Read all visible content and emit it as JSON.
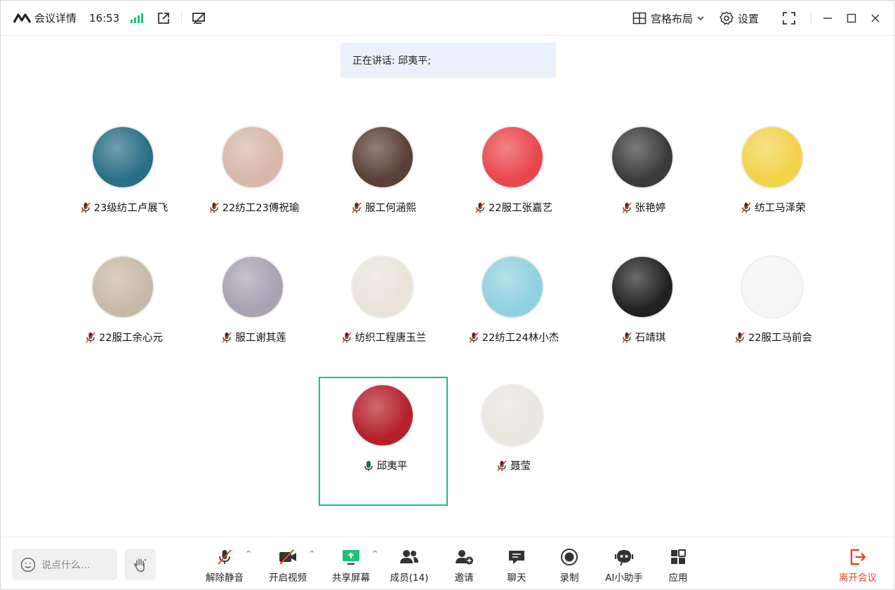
{
  "titlebar": {
    "title": "会议详情",
    "time": "16:53",
    "layout_label": "宫格布局",
    "settings_label": "设置"
  },
  "speaking": {
    "text": "正在讲话: 邱夷平;"
  },
  "participants": [
    {
      "name": "23级纺工卢展飞",
      "mic": "off",
      "avatar_color": "#2a6f86"
    },
    {
      "name": "22纺工23傅祝瑜",
      "mic": "off",
      "avatar_color": "#d8b7a8"
    },
    {
      "name": "服工何涵熙",
      "mic": "off",
      "avatar_color": "#5a4036"
    },
    {
      "name": "22服工张嘉艺",
      "mic": "off",
      "avatar_color": "#e8474d"
    },
    {
      "name": "张艳婷",
      "mic": "off",
      "avatar_color": "#3b3b3b"
    },
    {
      "name": "纺工马泽荣",
      "mic": "off",
      "avatar_color": "#f2d24a"
    },
    {
      "name": "22服工余心元",
      "mic": "off",
      "avatar_color": "#c9b8a6"
    },
    {
      "name": "服工谢其莲",
      "mic": "off",
      "avatar_color": "#a9a2b3"
    },
    {
      "name": "纺织工程唐玉兰",
      "mic": "off",
      "avatar_color": "#e9e3da"
    },
    {
      "name": "22纺工24林小杰",
      "mic": "off",
      "avatar_color": "#8fd1e0"
    },
    {
      "name": "石靖琪",
      "mic": "off",
      "avatar_color": "#222222"
    },
    {
      "name": "22服工马前会",
      "mic": "off",
      "avatar_color": "#f6f6f6"
    },
    {
      "name": "邱夷平",
      "mic": "on",
      "avatar_color": "#b5202b"
    },
    {
      "name": "聂莹",
      "mic": "off",
      "avatar_color": "#e9e6df"
    }
  ],
  "toolbar": {
    "chat_placeholder": "说点什么...",
    "unmute_label": "解除静音",
    "video_label": "开启视频",
    "share_label": "共享屏幕",
    "members_label": "成员(14)",
    "invite_label": "邀请",
    "chat_label": "聊天",
    "record_label": "录制",
    "ai_label": "AI小助手",
    "apps_label": "应用",
    "leave_label": "离开会议"
  },
  "colors": {
    "accent_green": "#1ec178",
    "leave_red": "#e8452c",
    "speaking_bg": "#eaf1fd"
  }
}
